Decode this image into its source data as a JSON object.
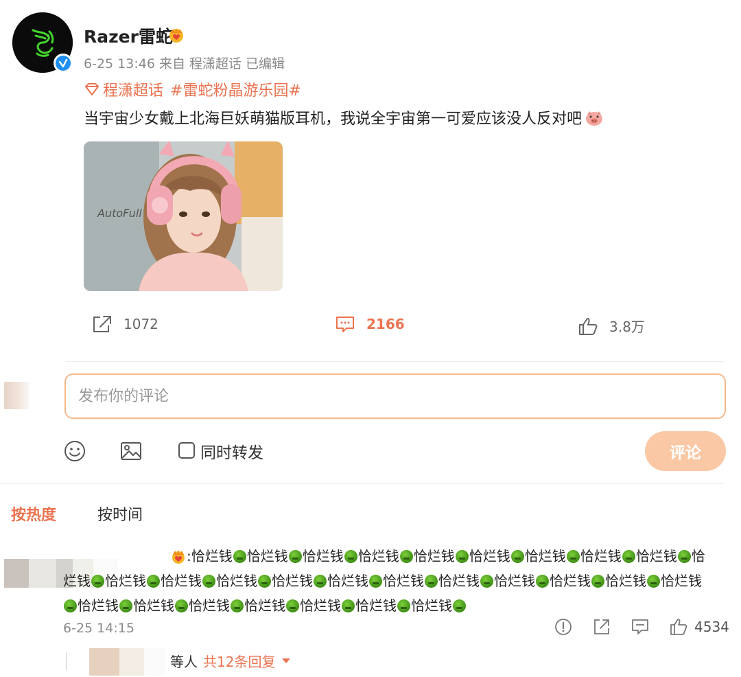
{
  "post": {
    "author": "Razer雷蛇",
    "meta": "6-25 13:46  来自 程潇超话 已编辑",
    "topic_supertopic": "程潇超话",
    "topic_hashtag": "#雷蛇粉晶游乐园#",
    "text": "当宇宙少女戴上北海巨妖萌猫版耳机，我说全宇宙第一可爱应该没人反对吧",
    "photo_caption": "AutoFull",
    "icons": {
      "avatar": "razer-logo-icon",
      "verified": "verified-icon",
      "badge": "crown-icon",
      "emoji": "pig-emoji-icon"
    },
    "colors": {
      "accent": "#eb7350",
      "verified": "#1d8ff2",
      "razer_green": "#44d62c"
    }
  },
  "actions": {
    "repost_count": "1072",
    "comment_count": "2166",
    "like_count": "3.8万"
  },
  "composer": {
    "placeholder": "发布你的评论",
    "forward_label": "同时转发",
    "forward_checked": false,
    "submit_label": "评论"
  },
  "sort_tabs": {
    "hot": "按热度",
    "time": "按时间",
    "active": "hot"
  },
  "comment": {
    "text_unit": "恰烂钱",
    "time": "6-25 14:15",
    "like_count": "4534",
    "reply_prefix": "等人",
    "reply_link": "共12条回复",
    "icons": [
      "report-icon",
      "share-icon",
      "comment-icon",
      "like-icon"
    ]
  }
}
